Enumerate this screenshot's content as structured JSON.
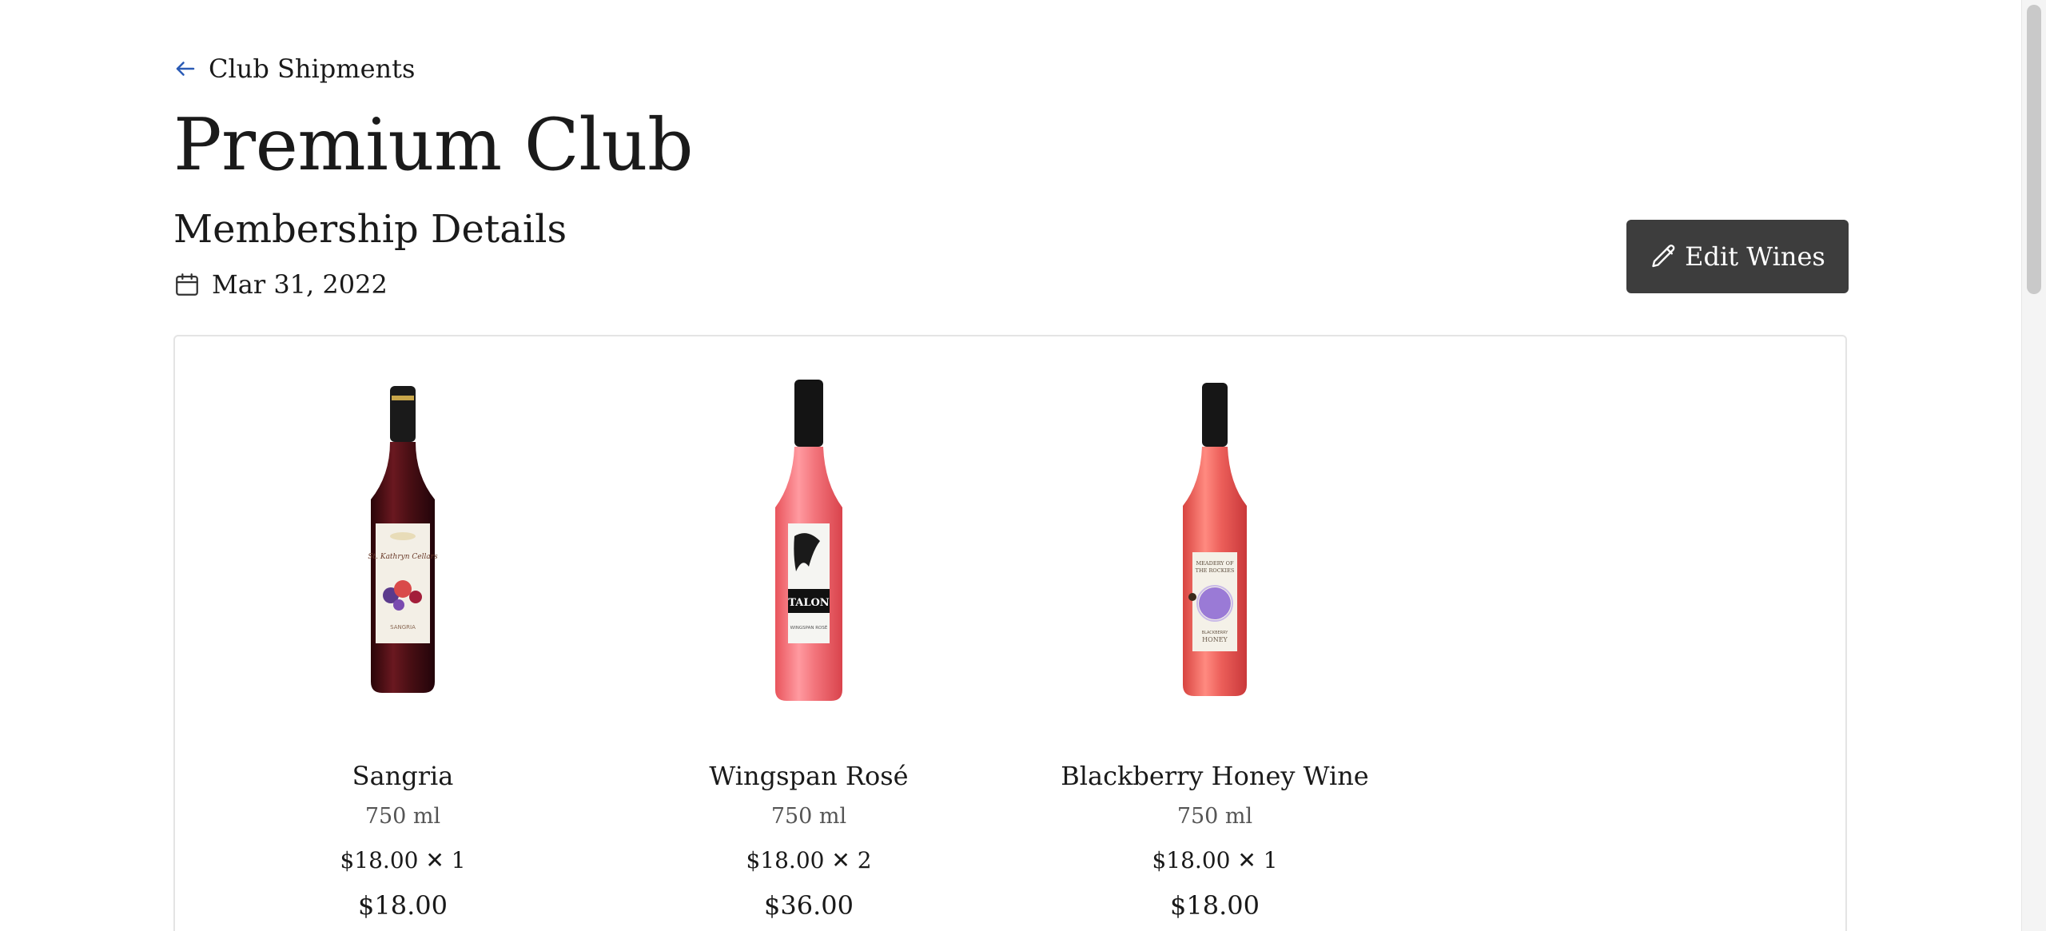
{
  "nav": {
    "back_label": "Club Shipments"
  },
  "header": {
    "title": "Premium Club",
    "section_title": "Membership Details",
    "date": "Mar 31, 2022"
  },
  "toolbar": {
    "edit_label": "Edit Wines"
  },
  "wines": [
    {
      "name": "Sangria",
      "volume": "750 ml",
      "unit_qty": "$18.00 ✕ 1",
      "total": "$18.00",
      "bottle_color": "#4a0f14",
      "label_text": "SANGRIA"
    },
    {
      "name": "Wingspan Rosé",
      "volume": "750 ml",
      "unit_qty": "$18.00 ✕ 2",
      "total": "$36.00",
      "bottle_color": "#f2737a",
      "label_text": "TALON"
    },
    {
      "name": "Blackberry Honey Wine",
      "volume": "750 ml",
      "unit_qty": "$18.00 ✕ 1",
      "total": "$18.00",
      "bottle_color": "#ec5f5a",
      "label_text": "MEADERY OF THE ROCKIES"
    }
  ],
  "colors": {
    "button_bg": "#3d3d3d",
    "accent_arrow": "#2b5bb5",
    "card_border": "#e4e4e4"
  }
}
